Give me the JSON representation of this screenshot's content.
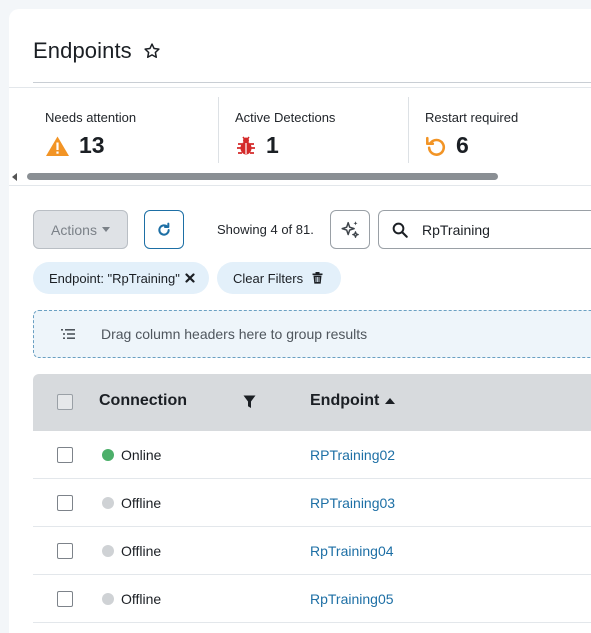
{
  "page": {
    "title": "Endpoints"
  },
  "cards": [
    {
      "label": "Needs attention",
      "value": "13",
      "icon": "warning-icon",
      "color": "#f29425"
    },
    {
      "label": "Active Detections",
      "value": "1",
      "icon": "bug-icon",
      "color": "#d42a2a"
    },
    {
      "label": "Restart required",
      "value": "6",
      "icon": "restart-icon",
      "color": "#f29425"
    }
  ],
  "toolbar": {
    "actions_label": "Actions",
    "showing_text": "Showing 4 of 81.",
    "search_value": "RpTraining"
  },
  "filters": {
    "chips": [
      {
        "label": "Endpoint: \"RpTraining\""
      }
    ],
    "clear_label": "Clear Filters"
  },
  "group_zone": {
    "text": "Drag column headers here to group results"
  },
  "table": {
    "columns": {
      "connection": "Connection",
      "endpoint": "Endpoint"
    },
    "rows": [
      {
        "connection": "Online",
        "status_color": "#4caf6a",
        "endpoint": "RPTraining02"
      },
      {
        "connection": "Offline",
        "status_color": "#cfd2d5",
        "endpoint": "RPTraining03"
      },
      {
        "connection": "Offline",
        "status_color": "#cfd2d5",
        "endpoint": "RpTraining04"
      },
      {
        "connection": "Offline",
        "status_color": "#cfd2d5",
        "endpoint": "RpTraining05"
      }
    ]
  },
  "colors": {
    "accent": "#1d6fa5",
    "chip_bg": "#e3f0fa"
  }
}
